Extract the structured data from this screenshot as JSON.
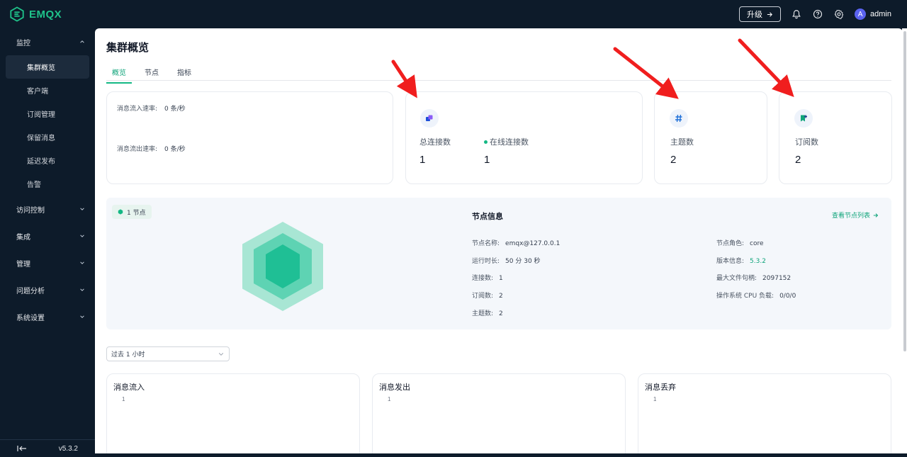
{
  "app": {
    "logo_text": "EMQX",
    "brand_color": "#1fc28a",
    "accent_color": "#14b884"
  },
  "topbar": {
    "upgrade_label": "升级",
    "upgrade_icon": "arrow-right-icon",
    "icons": [
      "bell-icon",
      "help-icon",
      "gear-icon"
    ],
    "avatar_letter": "A",
    "username": "admin"
  },
  "sidebar": {
    "groups": [
      {
        "label": "监控",
        "expanded": true,
        "items": [
          "集群概览",
          "客户端",
          "订阅管理",
          "保留消息",
          "延迟发布",
          "告警"
        ],
        "active_item": "集群概览"
      },
      {
        "label": "访问控制",
        "expanded": false
      },
      {
        "label": "集成",
        "expanded": false
      },
      {
        "label": "管理",
        "expanded": false
      },
      {
        "label": "问题分析",
        "expanded": false
      },
      {
        "label": "系统设置",
        "expanded": false
      }
    ],
    "version": "v5.3.2"
  },
  "page": {
    "title": "集群概览",
    "tabs": [
      {
        "label": "概览",
        "active": true
      },
      {
        "label": "节点",
        "active": false
      },
      {
        "label": "指标",
        "active": false
      }
    ]
  },
  "rates": {
    "in_label": "消息流入速率:",
    "in_value": "0 条/秒",
    "out_label": "消息流出速率:",
    "out_value": "0 条/秒"
  },
  "stats": {
    "connections": {
      "total_label": "总连接数",
      "total_value": "1",
      "online_label": "在线连接数",
      "online_value": "1"
    },
    "topics": {
      "label": "主题数",
      "value": "2"
    },
    "subscriptions": {
      "label": "订阅数",
      "value": "2"
    }
  },
  "node": {
    "badge": "1 节点",
    "info_title": "节点信息",
    "view_list": "查看节点列表",
    "left": [
      {
        "k": "节点名称:",
        "v": "emqx@127.0.0.1"
      },
      {
        "k": "运行时长:",
        "v": "50 分 30 秒"
      },
      {
        "k": "连接数:",
        "v": "1"
      },
      {
        "k": "订阅数:",
        "v": "2"
      },
      {
        "k": "主题数:",
        "v": "2"
      }
    ],
    "right": [
      {
        "k": "节点角色:",
        "v": "core"
      },
      {
        "k": "版本信息:",
        "v": "5.3.2"
      },
      {
        "k": "最大文件句柄:",
        "v": "2097152"
      },
      {
        "k": "操作系统 CPU 负载:",
        "v": "0/0/0"
      }
    ]
  },
  "metrics": {
    "time_range": "过去 1 小时",
    "charts": [
      {
        "title": "消息流入",
        "tick": "1"
      },
      {
        "title": "消息发出",
        "tick": "1"
      },
      {
        "title": "消息丢弃",
        "tick": "1"
      }
    ]
  }
}
